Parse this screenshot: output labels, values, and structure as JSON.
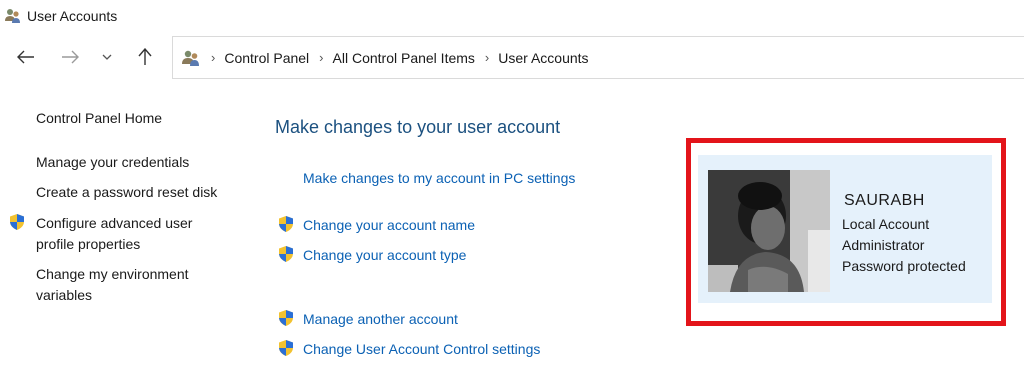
{
  "window": {
    "title": "User Accounts",
    "icon": "users-icon"
  },
  "nav": {
    "back_icon": "arrow-left-icon",
    "forward_icon": "arrow-right-icon",
    "recent_icon": "chevron-down-icon",
    "up_icon": "arrow-up-icon"
  },
  "address": {
    "icon": "users-icon",
    "crumbs": [
      "Control Panel",
      "All Control Panel Items",
      "User Accounts"
    ]
  },
  "sidebar": {
    "items": [
      {
        "label": "Control Panel Home",
        "shield": false
      },
      {
        "label": "Manage your credentials",
        "shield": false
      },
      {
        "label": "Create a password reset disk",
        "shield": false
      },
      {
        "label": "Configure advanced user",
        "label2": "profile properties",
        "shield": true
      },
      {
        "label": "Change my environment",
        "label2": "variables",
        "shield": false
      }
    ]
  },
  "main": {
    "heading": "Make changes to your user account",
    "tasks": [
      {
        "label": "Make changes to my account in PC settings",
        "shield": false
      },
      {
        "label": "Change your account name",
        "shield": true
      },
      {
        "label": "Change your account type",
        "shield": true
      },
      {
        "label": "Manage another account",
        "shield": true
      },
      {
        "label": "Change User Account Control settings",
        "shield": true
      }
    ]
  },
  "account": {
    "name": "SAURABH",
    "type": "Local Account",
    "role": "Administrator",
    "status": "Password protected"
  },
  "colors": {
    "link": "#0b61b4",
    "heading": "#1c5180",
    "card_bg": "#e5f1fb",
    "highlight": "#e3141a"
  }
}
